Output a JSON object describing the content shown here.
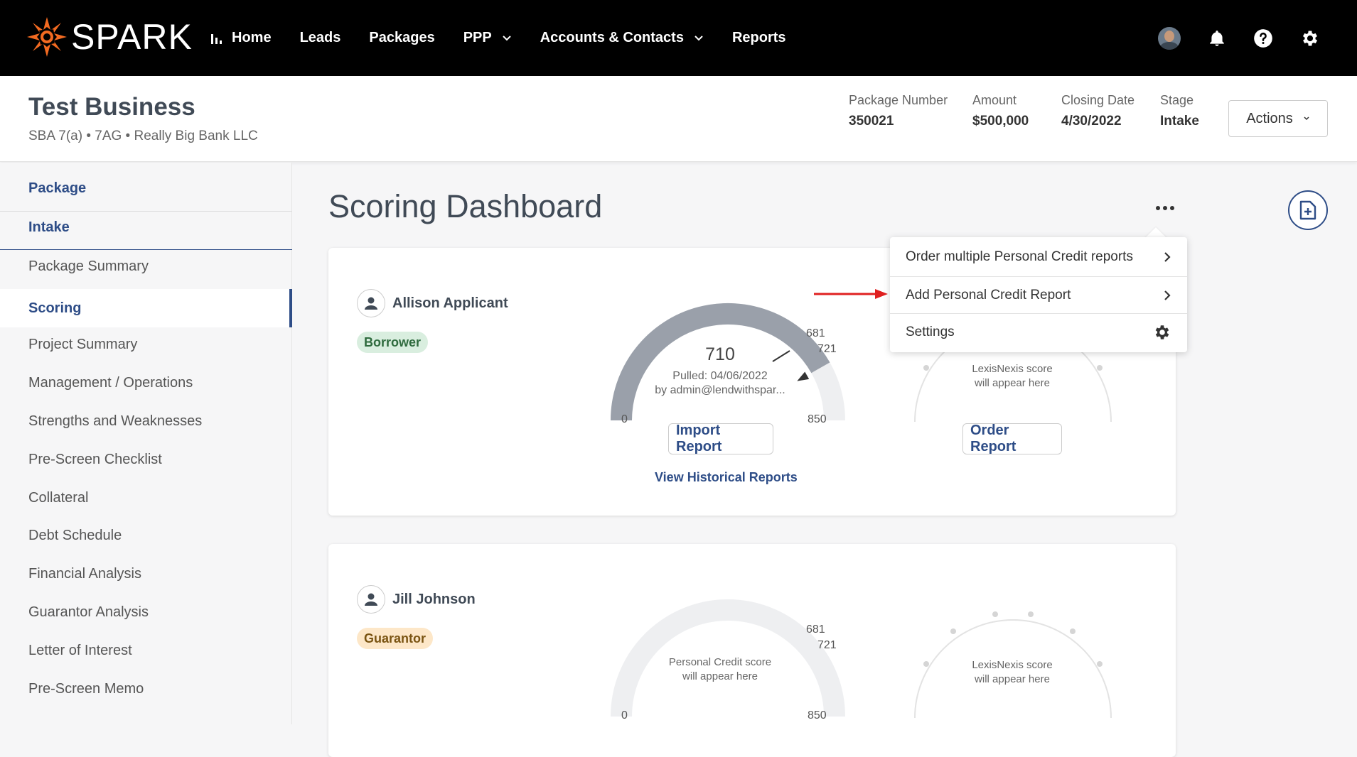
{
  "app": {
    "logo_text": "SPARK"
  },
  "nav": {
    "items": [
      {
        "label": "Home"
      },
      {
        "label": "Leads"
      },
      {
        "label": "Packages"
      },
      {
        "label": "PPP"
      },
      {
        "label": "Accounts & Contacts"
      },
      {
        "label": "Reports"
      }
    ]
  },
  "header": {
    "title": "Test Business",
    "subtitle": "SBA 7(a) • 7AG • Really Big Bank LLC",
    "meta": [
      {
        "label": "Package Number",
        "value": "350021"
      },
      {
        "label": "Amount",
        "value": "$500,000"
      },
      {
        "label": "Closing Date",
        "value": "4/30/2022"
      },
      {
        "label": "Stage",
        "value": "Intake"
      }
    ],
    "actions_label": "Actions"
  },
  "sidebar": {
    "items": [
      {
        "label": "Package"
      },
      {
        "label": "Intake"
      },
      {
        "label": "Package Summary"
      },
      {
        "label": "Scoring"
      },
      {
        "label": "Project Summary"
      },
      {
        "label": "Management / Operations"
      },
      {
        "label": "Strengths and Weaknesses"
      },
      {
        "label": "Pre-Screen Checklist"
      },
      {
        "label": "Collateral"
      },
      {
        "label": "Debt Schedule"
      },
      {
        "label": "Financial Analysis"
      },
      {
        "label": "Guarantor Analysis"
      },
      {
        "label": "Letter of Interest"
      },
      {
        "label": "Pre-Screen Memo"
      }
    ]
  },
  "main": {
    "title": "Scoring Dashboard",
    "cards": [
      {
        "name": "Allison Applicant",
        "role": "Borrower",
        "credit": {
          "score": "710",
          "score_value": 710,
          "min": "0",
          "max": "850",
          "marker_a": "681",
          "marker_b": "721",
          "pulled": "Pulled: 04/06/2022",
          "by": "by admin@lendwithspar...",
          "import_label": "Import Report",
          "history_label": "View Historical Reports"
        },
        "lexis": {
          "line1": "LexisNexis score",
          "line2": "will appear here",
          "order_label": "Order Report"
        }
      },
      {
        "name": "Jill Johnson",
        "role": "Guarantor",
        "credit": {
          "line1": "Personal Credit score",
          "line2": "will appear here",
          "min": "0",
          "max": "850",
          "marker_a": "681",
          "marker_b": "721"
        },
        "lexis": {
          "line1": "LexisNexis score",
          "line2": "will appear here"
        }
      }
    ]
  },
  "menu": {
    "items": [
      {
        "label": "Order multiple Personal Credit reports"
      },
      {
        "label": "Add Personal Credit Report"
      },
      {
        "label": "Settings"
      }
    ]
  },
  "colors": {
    "brand_orange": "#f26a21",
    "primary_blue": "#2e4d87",
    "gauge_filled": "#9aa0aa",
    "gauge_empty": "#eeeff1",
    "annotation_arrow": "#e02020"
  }
}
